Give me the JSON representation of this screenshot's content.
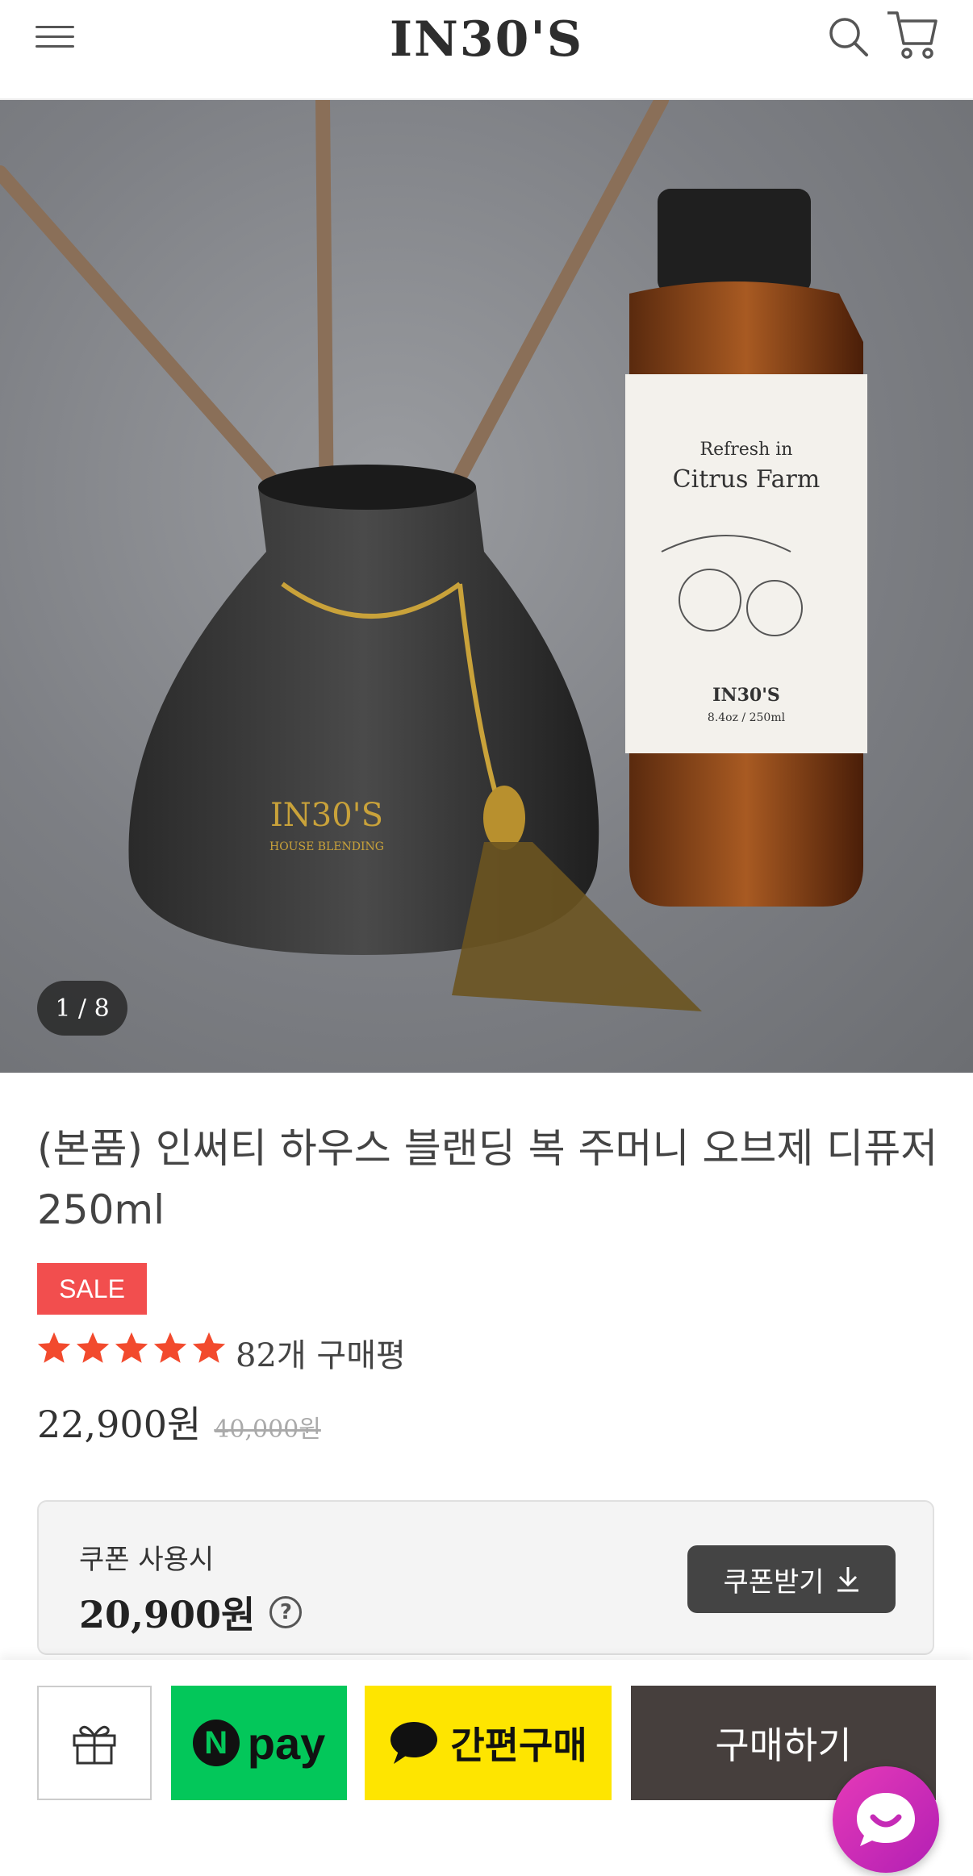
{
  "header": {
    "logo": "IN30'S",
    "icons": [
      "menu-icon",
      "search-icon",
      "cart-icon"
    ]
  },
  "gallery": {
    "counter": "1 / 8",
    "bottle_label_line1": "Refresh in",
    "bottle_label_line2": "Citrus Farm",
    "bottle_brand": "IN30'S",
    "bottle_volume": "8.4oz / 250ml",
    "diffuser_brand": "IN30'S",
    "diffuser_sub": "HOUSE BLENDING"
  },
  "product": {
    "title": "(본품) 인써티 하우스 블랜딩 복 주머니 오브제 디퓨저 250ml",
    "sale_badge": "SALE",
    "rating": 5,
    "review_count": "82개 구매평",
    "price": "22,900원",
    "original_price": "40,000원"
  },
  "coupon": {
    "label": "쿠폰 사용시",
    "price": "20,900원",
    "help": "?",
    "button_label": "쿠폰받기"
  },
  "bottom_bar": {
    "npay_label": "pay",
    "npay_logo": "N",
    "kakao_label": "간편구매",
    "buy_label": "구매하기"
  },
  "colors": {
    "sale": "#f24e4e",
    "star": "#f24a2d",
    "npay": "#03c75a",
    "kakao": "#fee500",
    "buy": "#463f3d",
    "chat": "#d22bb8"
  }
}
